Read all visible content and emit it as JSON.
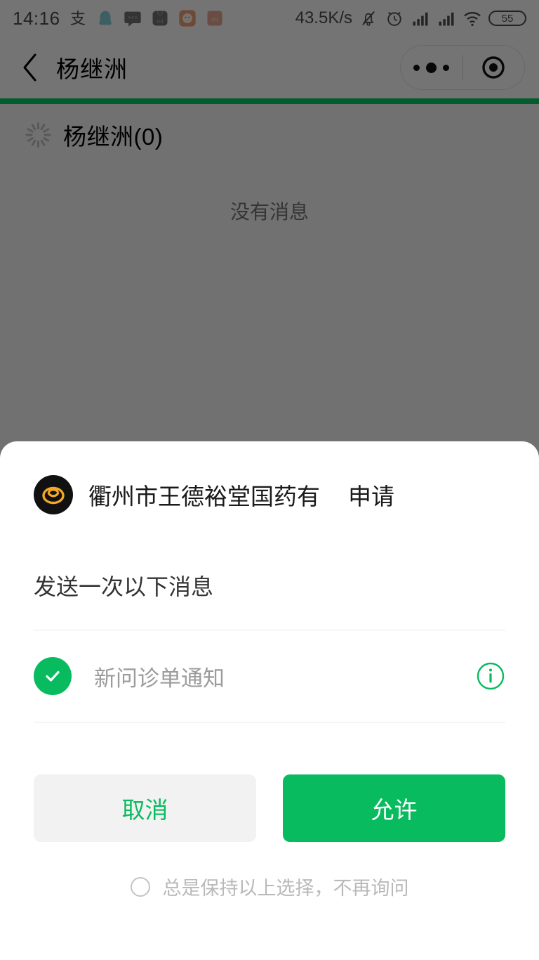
{
  "status_bar": {
    "time": "14:16",
    "network_speed": "43.5K/s",
    "battery_level": "55",
    "left_icons": [
      "alipay-icon",
      "qq-icon",
      "message-icon",
      "mi-store-icon",
      "app-orange-icon",
      "mi-app-icon"
    ],
    "right_icons": [
      "mute-bell-icon",
      "alarm-clock-icon",
      "signal-1-icon",
      "signal-2-icon",
      "wifi-icon",
      "battery-icon"
    ]
  },
  "nav": {
    "back_icon": "back-chevron-icon",
    "title": "杨继洲",
    "capsule": {
      "more_icon": "more-dots-icon",
      "target_icon": "target-circle-icon"
    }
  },
  "page": {
    "loading_row_label": "杨继洲(0)",
    "empty_text": "没有消息",
    "progress_percent": 100
  },
  "dialog": {
    "app_name": "衢州市王德裕堂国药有限...",
    "action_label": "申请",
    "logo_icon": "company-logo-icon",
    "subtitle": "发送一次以下消息",
    "messages": [
      {
        "label": "新问诊单通知",
        "checked": true,
        "check_icon": "check-circle-icon",
        "info_icon": "info-circle-icon"
      }
    ],
    "cancel_label": "取消",
    "allow_label": "允许",
    "always_label": "总是保持以上选择，不再询问",
    "always_checked": false
  },
  "colors": {
    "brand_green": "#09bb5f",
    "progress_green": "#07c160",
    "logo_accent": "#f5a623",
    "dim_overlay": "rgba(0,0,0,0.52)"
  }
}
